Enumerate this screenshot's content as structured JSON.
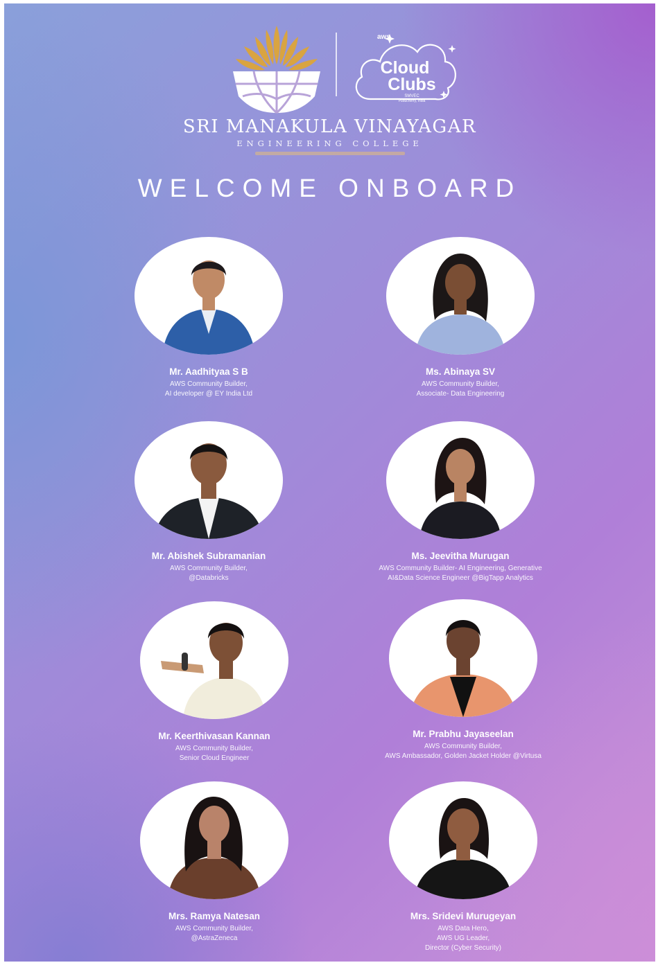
{
  "header": {
    "college_name": "SRI MANAKULA VINAYAGAR",
    "college_subtitle": "ENGINEERING COLLEGE",
    "club_logo": {
      "brand": "aws",
      "line1": "Cloud",
      "line2": "Clubs",
      "line3": "SMVEC",
      "line4": "Puducherry, India"
    }
  },
  "headline": "WELCOME ONBOARD",
  "speakers": [
    {
      "name": "Mr. Aadhityaa S B",
      "role_line1": "AWS Community Builder,",
      "role_line2": "AI developer @ EY India Ltd",
      "role_line3": ""
    },
    {
      "name": "Ms. Abinaya SV",
      "role_line1": "AWS Community Builder,",
      "role_line2": "Associate- Data Engineering",
      "role_line3": ""
    },
    {
      "name": "Mr. Abishek Subramanian",
      "role_line1": "AWS Community Builder,",
      "role_line2": "@Databricks",
      "role_line3": ""
    },
    {
      "name": "Ms. Jeevitha Murugan",
      "role_line1": "AWS Community Builder- AI Engineering, Generative",
      "role_line2": "AI&Data Science Engineer @BigTapp Analytics",
      "role_line3": ""
    },
    {
      "name": "Mr. Keerthivasan Kannan",
      "role_line1": "AWS Community Builder,",
      "role_line2": "Senior Cloud Engineer",
      "role_line3": ""
    },
    {
      "name": "Mr. Prabhu Jayaseelan",
      "role_line1": "AWS Community Builder,",
      "role_line2": "AWS Ambassador, Golden Jacket Holder @Virtusa",
      "role_line3": ""
    },
    {
      "name": "Mrs. Ramya Natesan",
      "role_line1": "AWS Community Builder,",
      "role_line2": "@AstraZeneca",
      "role_line3": ""
    },
    {
      "name": "Mrs. Sridevi Murugeyan",
      "role_line1": "AWS Data Hero,",
      "role_line2": "AWS UG Leader,",
      "role_line3": "Director (Cyber Security)"
    }
  ],
  "colors": {
    "background_left": "#8aa0da",
    "background_right": "#b07fd8",
    "logo_gold": "#d9a441",
    "text": "#ffffff"
  }
}
